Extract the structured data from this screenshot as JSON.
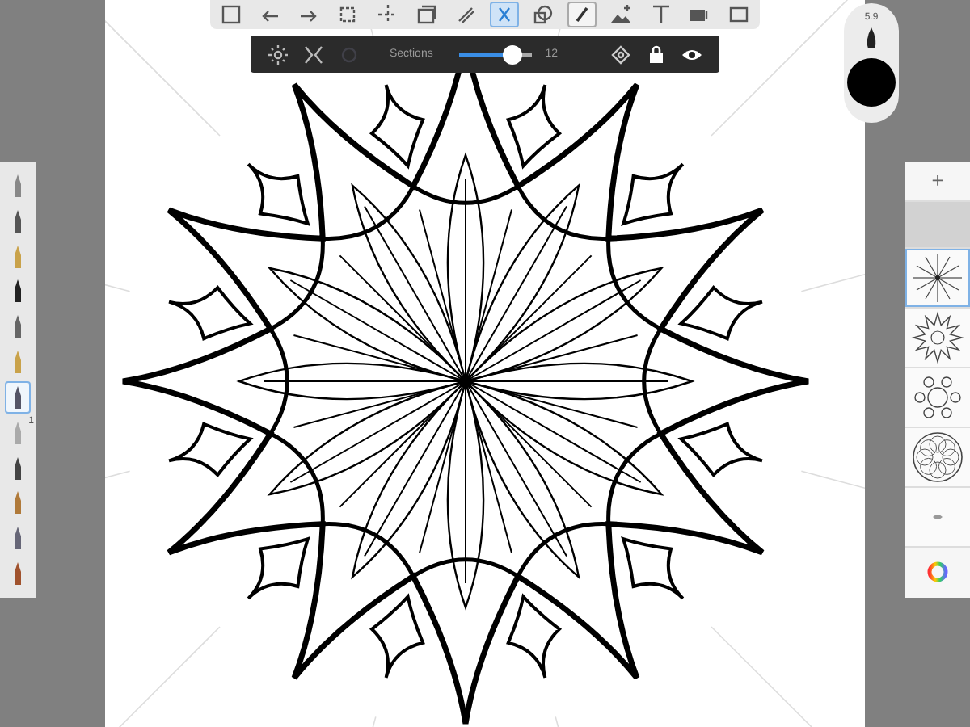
{
  "toolbar": {
    "tools": [
      {
        "selected": false,
        "active": false
      },
      {
        "selected": false,
        "active": false
      },
      {
        "selected": false,
        "active": false
      },
      {
        "selected": false,
        "active": false
      },
      {
        "selected": false,
        "active": false
      },
      {
        "selected": false,
        "active": false
      },
      {
        "selected": false,
        "active": false
      },
      {
        "selected": true,
        "active": false
      },
      {
        "selected": false,
        "active": false
      },
      {
        "selected": false,
        "active": true
      },
      {
        "selected": false,
        "active": false
      },
      {
        "selected": false,
        "active": false
      },
      {
        "selected": false,
        "active": false
      },
      {
        "selected": false,
        "active": false
      }
    ]
  },
  "symmetry_bar": {
    "label": "Sections",
    "level": 0.72,
    "reading": "12",
    "locked": true,
    "visible": true
  },
  "brush_puck": {
    "size": "5.9"
  },
  "brush_bar": {
    "brushes": [
      {
        "selected": false
      },
      {
        "selected": false
      },
      {
        "selected": false
      },
      {
        "selected": false
      },
      {
        "selected": false
      },
      {
        "selected": false
      },
      {
        "selected": true
      },
      {
        "selected": false,
        "badge": "1"
      },
      {
        "selected": false
      },
      {
        "selected": false
      },
      {
        "selected": false
      },
      {
        "selected": false
      }
    ]
  },
  "layers_panel": {
    "add_label": "+",
    "layers": [
      {
        "selected": true
      },
      {
        "selected": false
      },
      {
        "selected": false
      },
      {
        "selected": false
      },
      {
        "selected": false
      }
    ]
  }
}
